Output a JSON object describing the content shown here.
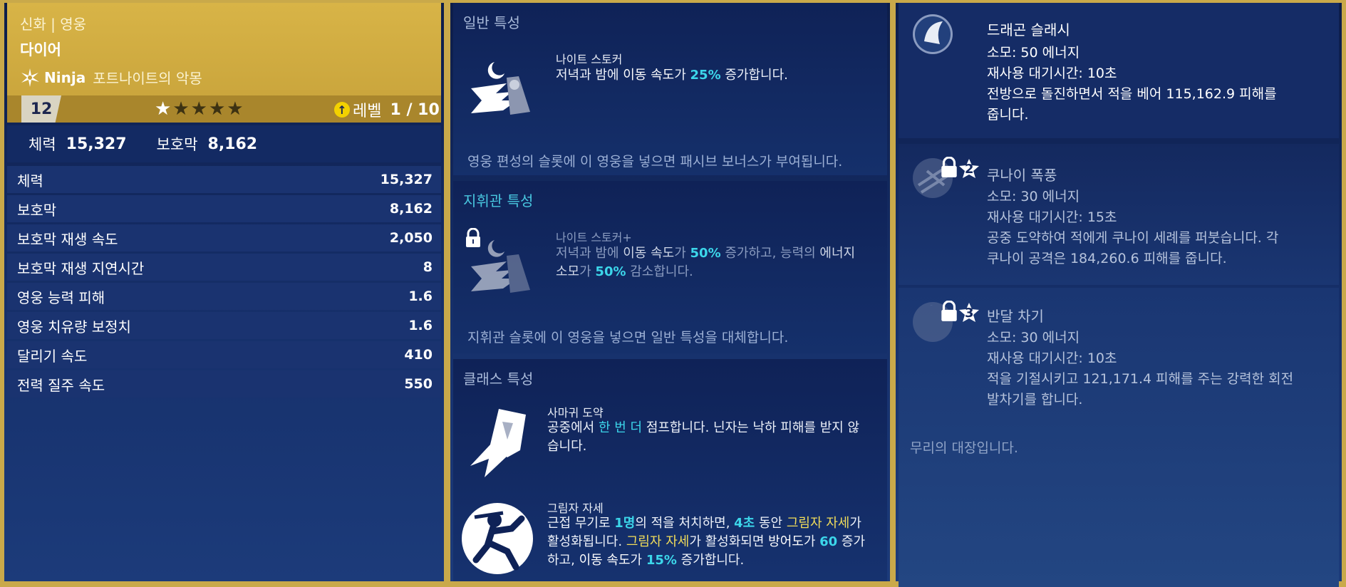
{
  "hero": {
    "rarity_type": "신화 | 영웅",
    "name": "다이어",
    "class": "Ninja",
    "subclass": "포트나이트의 악몽",
    "power_level": "12",
    "stars_filled": 1,
    "stars_total": 5,
    "level_label": "레벨",
    "level_value": "1 / 10"
  },
  "quick_stats": {
    "health_label": "체력",
    "health_value": "15,327",
    "shield_label": "보호막",
    "shield_value": "8,162"
  },
  "stats": [
    {
      "label": "체력",
      "value": "15,327"
    },
    {
      "label": "보호막",
      "value": "8,162"
    },
    {
      "label": "보호막 재생 속도",
      "value": "2,050"
    },
    {
      "label": "보호막 재생 지연시간",
      "value": "8"
    },
    {
      "label": "영웅 능력 피해",
      "value": "1.6"
    },
    {
      "label": "영웅 치유량 보정치",
      "value": "1.6"
    },
    {
      "label": "달리기 속도",
      "value": "410"
    },
    {
      "label": "전력 질주 속도",
      "value": "550"
    }
  ],
  "standard_perk": {
    "section_title": "일반 특성",
    "name": "나이트 스토커",
    "footer": "영웅 편성의 슬롯에 이 영웅을 넣으면 패시브 보너스가 부여됩니다."
  },
  "commander_perk": {
    "section_title": "지휘관 특성",
    "name": "나이트 스토커+",
    "footer": "지휘관 슬롯에 이 영웅을 넣으면 일반 특성을 대체합니다."
  },
  "class_perks": {
    "section_title": "클래스 특성",
    "perk1_name": "사마귀 도약",
    "perk2_name": "그림자 자세"
  },
  "abilities": {
    "a1_name": "드래곤 슬래시",
    "a1_cost": "소모: 50 에너지",
    "a1_cd": "재사용 대기시간: 10초",
    "a1_desc1": "전방으로 돌진하면서 적을 베어 115,162.9 피해를",
    "a1_desc2": "줍니다.",
    "a2_name": "쿠나이 폭풍",
    "a2_unlock": "2",
    "a2_cost": "소모: 30 에너지",
    "a2_cd": "재사용 대기시간: 15초",
    "a2_desc1": "공중 도약하여 적에게 쿠나이 세례를 퍼붓습니다. 각",
    "a2_desc2": "쿠나이 공격은 184,260.6 피해를 줍니다.",
    "a3_name": "반달 차기",
    "a3_unlock": "3",
    "a3_cost": "소모: 30 에너지",
    "a3_cd": "재사용 대기시간: 10초",
    "a3_desc1": "적을 기절시키고 121,171.4 피해를 주는 강력한 회전",
    "a3_desc2": "발차기를 합니다.",
    "lore": "무리의 대장입니다."
  },
  "colors": {
    "gold": "#c9a94a",
    "highlight_cyan": "#3cd6ea",
    "highlight_yellow": "#f2dd5a",
    "panel_blue": "#132a63"
  }
}
